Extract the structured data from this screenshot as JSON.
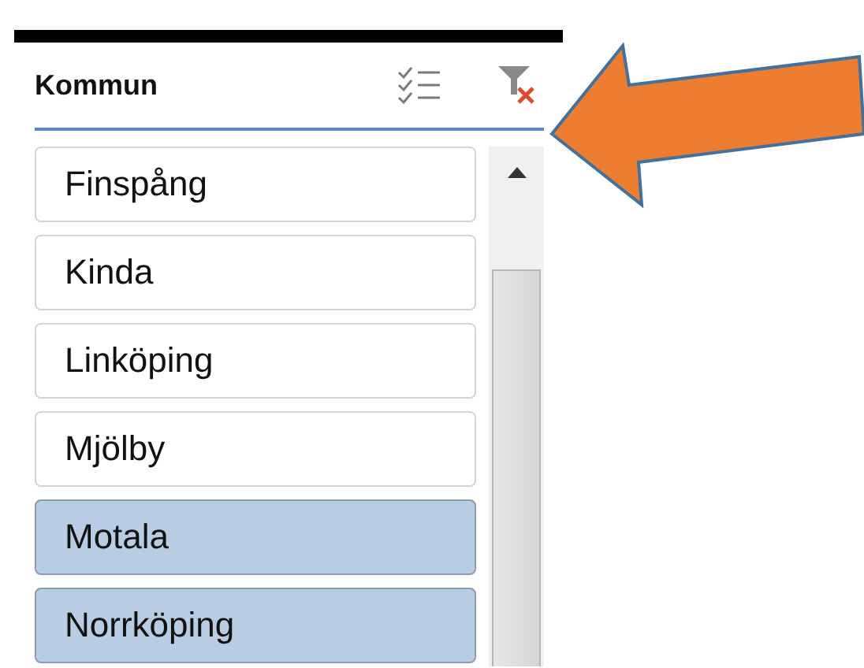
{
  "slicer": {
    "title": "Kommun",
    "items": [
      {
        "label": "Finspång",
        "selected": false
      },
      {
        "label": "Kinda",
        "selected": false
      },
      {
        "label": "Linköping",
        "selected": false
      },
      {
        "label": "Mjölby",
        "selected": false
      },
      {
        "label": "Motala",
        "selected": true
      },
      {
        "label": "Norrköping",
        "selected": true
      }
    ]
  }
}
